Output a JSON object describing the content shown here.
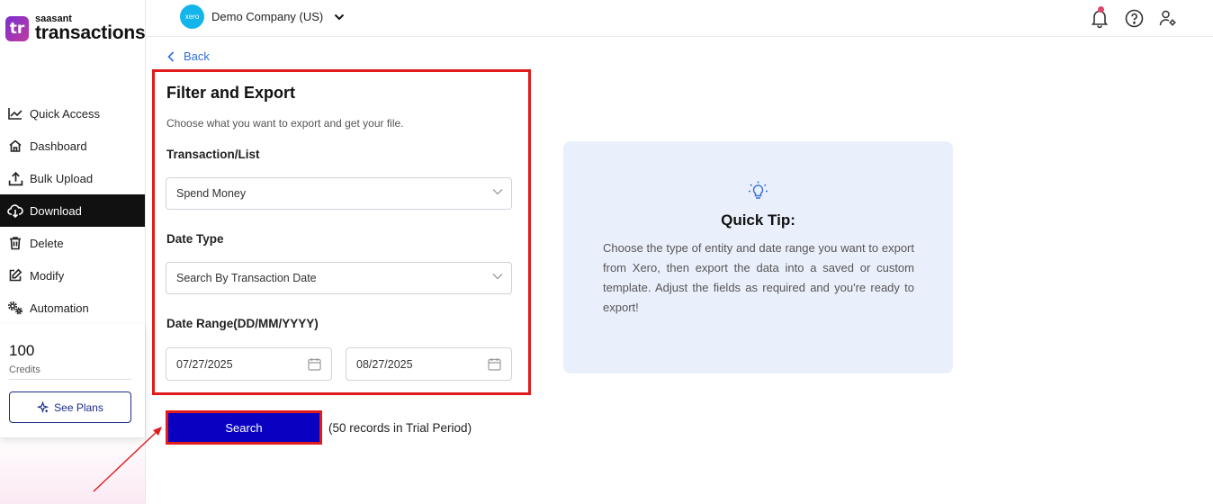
{
  "brand": {
    "logo_text": "tr",
    "small": "saasant",
    "big": "transactions"
  },
  "sidebar": {
    "items": [
      {
        "label": "Quick Access",
        "icon": "chart-line-icon"
      },
      {
        "label": "Dashboard",
        "icon": "home-icon"
      },
      {
        "label": "Bulk Upload",
        "icon": "upload-icon"
      },
      {
        "label": "Download",
        "icon": "cloud-download-icon",
        "active": true
      },
      {
        "label": "Delete",
        "icon": "trash-icon"
      },
      {
        "label": "Modify",
        "icon": "edit-icon"
      },
      {
        "label": "Automation",
        "icon": "gears-icon"
      }
    ]
  },
  "credits": {
    "count": "100",
    "label": "Credits",
    "plans_label": "See Plans"
  },
  "topbar": {
    "company_logo_text": "xero",
    "company_name": "Demo Company (US)"
  },
  "back_label": "Back",
  "filter": {
    "title": "Filter and Export",
    "subtitle": "Choose what you want to export and get your file.",
    "transaction_label": "Transaction/List",
    "transaction_value": "Spend Money",
    "date_type_label": "Date Type",
    "date_type_value": "Search By Transaction Date",
    "date_range_label": "Date Range(DD/MM/YYYY)",
    "date_from": "07/27/2025",
    "date_to": "08/27/2025"
  },
  "search": {
    "label": "Search",
    "note": "(50 records in Trial Period)"
  },
  "tip": {
    "title": "Quick Tip:",
    "text": "Choose the type of entity and date range you want to export from Xero, then export the data into a saved or custom template. Adjust the fields as required and you're ready to export!"
  },
  "colors": {
    "highlight": "#e01b1b",
    "search_button": "#0a00c2",
    "link": "#2f6fd8",
    "tip_bg": "#eaf0fb",
    "active_nav": "#111111"
  }
}
